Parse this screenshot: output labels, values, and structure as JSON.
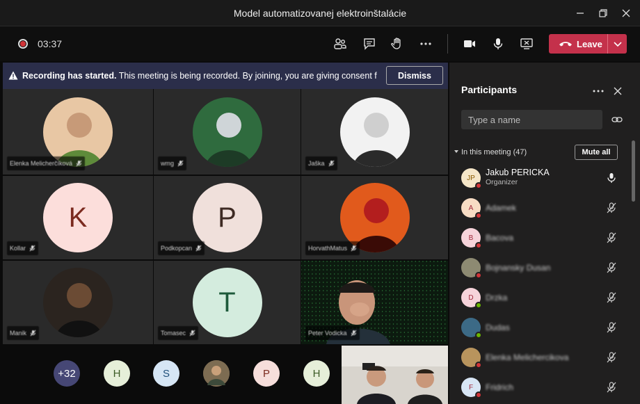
{
  "window": {
    "title": "Model automatizovanej elektroinštalácie"
  },
  "toolbar": {
    "timer": "03:37",
    "leave_label": "Leave"
  },
  "banner": {
    "heading": "Recording has started.",
    "message": "This meeting is being recorded. By joining, you are giving consent fo...",
    "dismiss_label": "Dismiss"
  },
  "tiles": [
    {
      "name": "Elenka Melicherčíková",
      "kind": "photo",
      "colors": [
        "#e8c7a4",
        "#c79a78",
        "#5e8b3a"
      ]
    },
    {
      "name": "wmg",
      "kind": "photo",
      "colors": [
        "#2f6b3e",
        "#cfd5d8",
        "#1d3b26"
      ]
    },
    {
      "name": "Jaška",
      "kind": "photo",
      "colors": [
        "#f2f2f2",
        "#cfcfcf",
        "#2a2a2a"
      ]
    },
    {
      "name": "Kollar",
      "kind": "letter",
      "letter": "K",
      "bg": "#fcdedb",
      "fg": "#7b2a1f"
    },
    {
      "name": "Podkopcan",
      "kind": "letter",
      "letter": "P",
      "bg": "#f0e0db",
      "fg": "#3e2a23"
    },
    {
      "name": "HorvathMatus",
      "kind": "photo",
      "colors": [
        "#e15a1c",
        "#b31e1e",
        "#3a0b06"
      ]
    },
    {
      "name": "Manik",
      "kind": "photo",
      "colors": [
        "#2b241f",
        "#6b4b34",
        "#111"
      ]
    },
    {
      "name": "Tomasec",
      "kind": "letter",
      "letter": "T",
      "bg": "#d4ecde",
      "fg": "#1e5a3b"
    },
    {
      "name": "Peter Vodicka",
      "kind": "video"
    }
  ],
  "bottom_chips": [
    {
      "text": "+32",
      "bg": "#464775",
      "fg": "#ffffff"
    },
    {
      "text": "H",
      "bg": "#e6efd9",
      "fg": "#3b5b25"
    },
    {
      "text": "S",
      "bg": "#d6e6f5",
      "fg": "#1f4f7a"
    },
    {
      "text": "",
      "bg": "#7d6c52",
      "fg": "#ffffff"
    },
    {
      "text": "P",
      "bg": "#f6dedb",
      "fg": "#7b2a1f"
    },
    {
      "text": "H",
      "bg": "#e6efd9",
      "fg": "#3b5b25"
    }
  ],
  "panel": {
    "title": "Participants",
    "search_placeholder": "Type a name",
    "section_label": "In this meeting (47)",
    "mute_all_label": "Mute all",
    "organizer": {
      "initials": "JP",
      "name": "Jakub PERICKA",
      "role": "Organizer"
    },
    "participants": [
      {
        "initials": "A",
        "name": "Adamek",
        "bg": "#f7dcc4",
        "status": "#d13438"
      },
      {
        "initials": "B",
        "name": "Bacova",
        "bg": "#f6d3da",
        "status": "#d13438"
      },
      {
        "initials": "",
        "name": "Bojnansky Dusan",
        "bg": "#8d8a72",
        "status": "#d13438"
      },
      {
        "initials": "D",
        "name": "Drzka",
        "bg": "#f6d3da",
        "status": "#6bb700"
      },
      {
        "initials": "",
        "name": "Dudas",
        "bg": "#3c6a86",
        "status": "#6bb700"
      },
      {
        "initials": "",
        "name": "Elenka Melichercikova",
        "bg": "#b8945d",
        "status": "#d13438"
      },
      {
        "initials": "F",
        "name": "Fridrich",
        "bg": "#d8e6f5",
        "status": "#d13438"
      }
    ]
  },
  "colors": {
    "leave": "#c4314b",
    "banner": "#2b2e4a",
    "accent": "#464775"
  }
}
